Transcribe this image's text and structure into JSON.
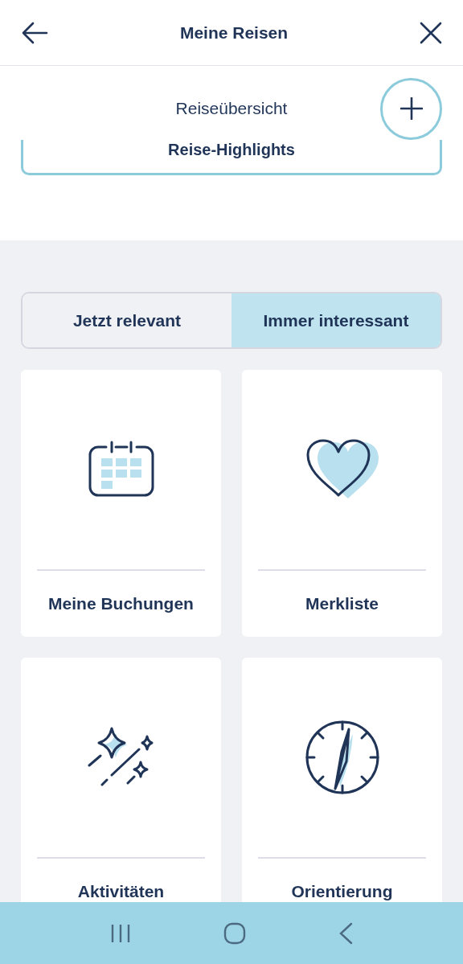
{
  "header": {
    "title": "Meine Reisen"
  },
  "overview": {
    "title": "Reiseübersicht",
    "highlights_label": "Reise-Highlights"
  },
  "segments": [
    {
      "label": "Jetzt relevant",
      "selected": false
    },
    {
      "label": "Immer interessant",
      "selected": true
    }
  ],
  "tiles": [
    {
      "kind": "calendar",
      "label": "Meine Buchungen"
    },
    {
      "kind": "heart",
      "label": "Merkliste"
    },
    {
      "kind": "sparkles",
      "label": "Aktivitäten"
    },
    {
      "kind": "compass",
      "label": "Orientierung"
    }
  ]
}
